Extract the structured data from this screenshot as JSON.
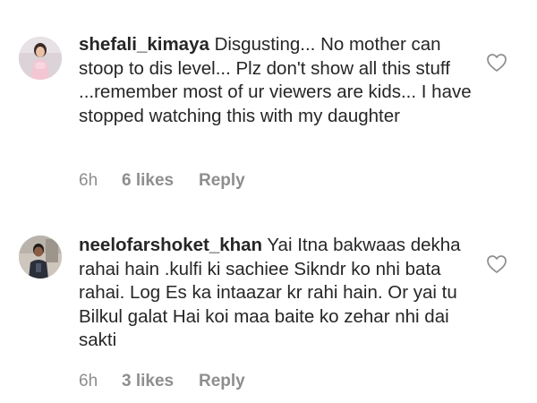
{
  "comments": [
    {
      "username": "shefali_kimaya",
      "text": "Disgusting... No mother can stoop to dis level... Plz don't show all this stuff ...remember most of ur viewers are kids... I have stopped watching this with my daughter",
      "time": "6h",
      "likes": "6 likes",
      "reply": "Reply",
      "avatar_icon": "avatar-girl-pink-dress",
      "like_icon": "heart-outline-icon"
    },
    {
      "username": "neelofarshoket_khan",
      "text": "Yai Itna bakwaas dekha rahai hain .kulfi ki sachiee Sikndr ko nhi bata rahai.  Log Es ka intaazar kr rahi hain.  Or yai tu Bilkul galat Hai  koi maa baite ko zehar nhi dai sakti",
      "time": "6h",
      "likes": "3 likes",
      "reply": "Reply",
      "avatar_icon": "avatar-man-photo",
      "like_icon": "heart-outline-icon"
    }
  ],
  "colors": {
    "text": "#262626",
    "meta": "#8e8e8e",
    "background": "#ffffff"
  }
}
